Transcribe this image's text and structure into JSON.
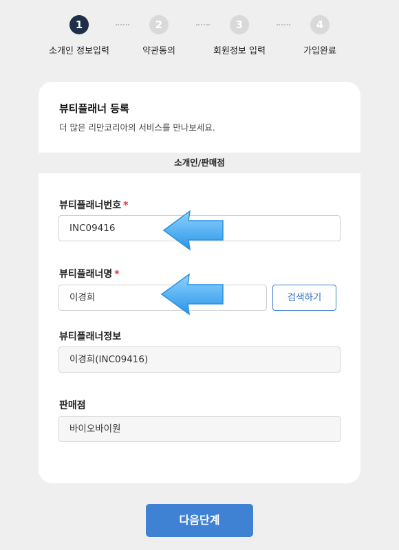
{
  "stepper": {
    "steps": [
      {
        "num": "1",
        "label": "소개인 정보입력",
        "active": true
      },
      {
        "num": "2",
        "label": "약관동의",
        "active": false
      },
      {
        "num": "3",
        "label": "회원정보 입력",
        "active": false
      },
      {
        "num": "4",
        "label": "가입완료",
        "active": false
      }
    ]
  },
  "card": {
    "title": "뷰티플래너 등록",
    "subtitle": "더 많은 리만코리아의 서비스를 만나보세요.",
    "section": "소개인/판매점"
  },
  "fields": {
    "planner_no": {
      "label": "뷰티플래너번호",
      "required": "*",
      "value": "INC09416"
    },
    "planner_name": {
      "label": "뷰티플래너명",
      "required": "*",
      "value": "이경희"
    },
    "planner_info": {
      "label": "뷰티플래너정보",
      "value": "이경희(INC09416)"
    },
    "store": {
      "label": "판매점",
      "value": "바이오바이원"
    }
  },
  "buttons": {
    "search": "검색하기",
    "next": "다음단계"
  },
  "colors": {
    "accent": "#3f82d3",
    "step_active": "#1f2f47",
    "required": "#e03a3a",
    "annotation_arrow": "#4aaef0"
  }
}
